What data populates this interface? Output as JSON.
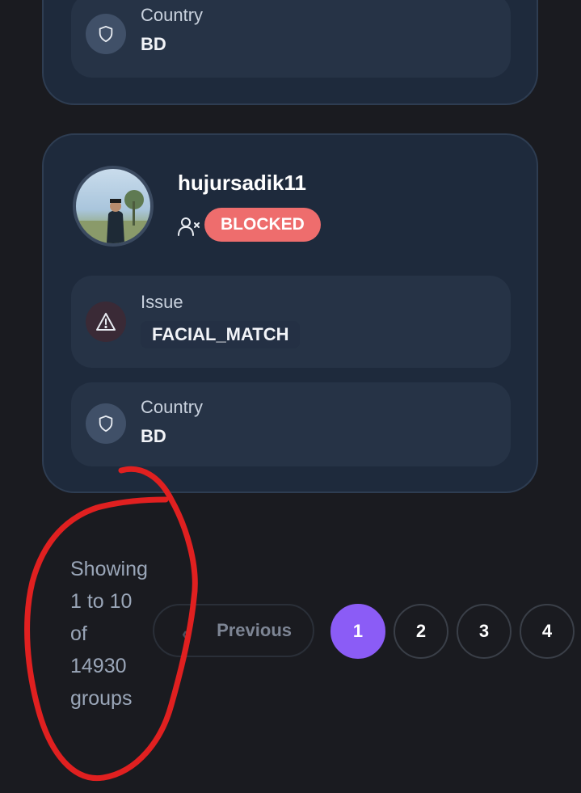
{
  "cards": [
    {
      "country": {
        "label": "Country",
        "value": "BD"
      }
    },
    {
      "username": "hujursadik11",
      "status_badge": "BLOCKED",
      "issue": {
        "label": "Issue",
        "value": "FACIAL_MATCH"
      },
      "country": {
        "label": "Country",
        "value": "BD"
      }
    }
  ],
  "pagination": {
    "showing_lines": [
      "Showing",
      "1 to 10",
      "of",
      "14930",
      "groups"
    ],
    "previous_label": "Previous",
    "pages": [
      "1",
      "2",
      "3",
      "4"
    ],
    "active_page": "1"
  },
  "colors": {
    "accent": "#8b5cf6",
    "blocked": "#ee6d6d",
    "annotation": "#e02020"
  },
  "icons": [
    "shield-icon",
    "warning-icon",
    "user-x-icon",
    "chevron-left-icon"
  ]
}
